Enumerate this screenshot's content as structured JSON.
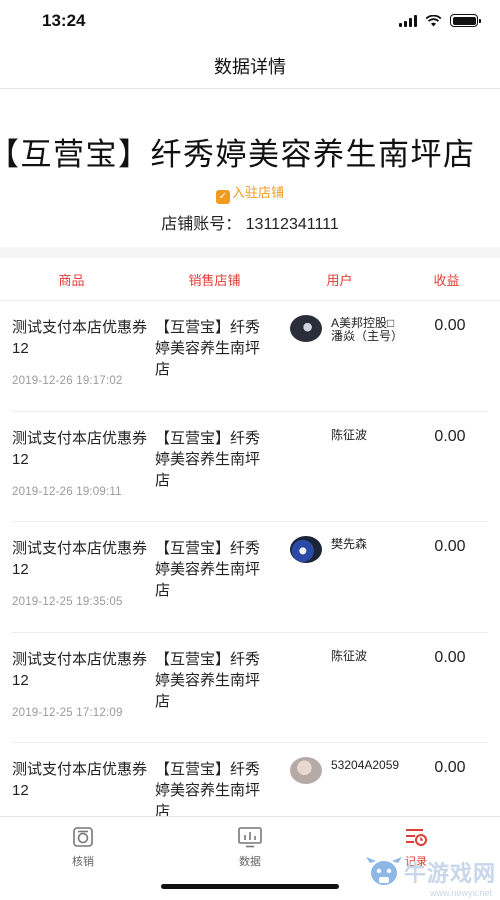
{
  "status_bar": {
    "time": "13:24"
  },
  "nav": {
    "title": "数据详情"
  },
  "store": {
    "name": "【互营宝】纤秀婷美容养生南坪店",
    "badge": "入驻店铺",
    "account": "店铺账号： 13112341111"
  },
  "table": {
    "headers": [
      "商品",
      "销售店铺",
      "用户",
      "收益"
    ],
    "rows": [
      {
        "product": "测试支付本店优惠券12",
        "time": "2019-12-26 19:17:02",
        "store": "【互营宝】纤秀婷美容养生南坪店",
        "user": "A美邦控股□ 潘焱（主号）",
        "avatar": "avatar-1",
        "income": "0.00"
      },
      {
        "product": "测试支付本店优惠券12",
        "time": "2019-12-26 19:09:11",
        "store": "【互营宝】纤秀婷美容养生南坪店",
        "user": "陈征波",
        "avatar": "",
        "income": "0.00"
      },
      {
        "product": "测试支付本店优惠券12",
        "time": "2019-12-25 19:35:05",
        "store": "【互营宝】纤秀婷美容养生南坪店",
        "user": "樊先森",
        "avatar": "avatar-2",
        "income": "0.00"
      },
      {
        "product": "测试支付本店优惠券12",
        "time": "2019-12-25 17:12:09",
        "store": "【互营宝】纤秀婷美容养生南坪店",
        "user": "陈征波",
        "avatar": "",
        "income": "0.00"
      },
      {
        "product": "测试支付本店优惠券12",
        "time": "",
        "store": "【互营宝】纤秀婷美容养生南坪店",
        "user": "53204A2059",
        "avatar": "avatar-3",
        "income": "0.00"
      }
    ]
  },
  "tabs": [
    {
      "label": "核销",
      "icon": "verify-icon",
      "active": false
    },
    {
      "label": "数据",
      "icon": "chart-icon",
      "active": false
    },
    {
      "label": "记录",
      "icon": "record-icon",
      "active": true
    }
  ],
  "watermark": {
    "text": "牛游戏网",
    "url": "www.newyx.net"
  },
  "colors": {
    "accent": "#e33c36",
    "badge": "#f19a1f"
  }
}
